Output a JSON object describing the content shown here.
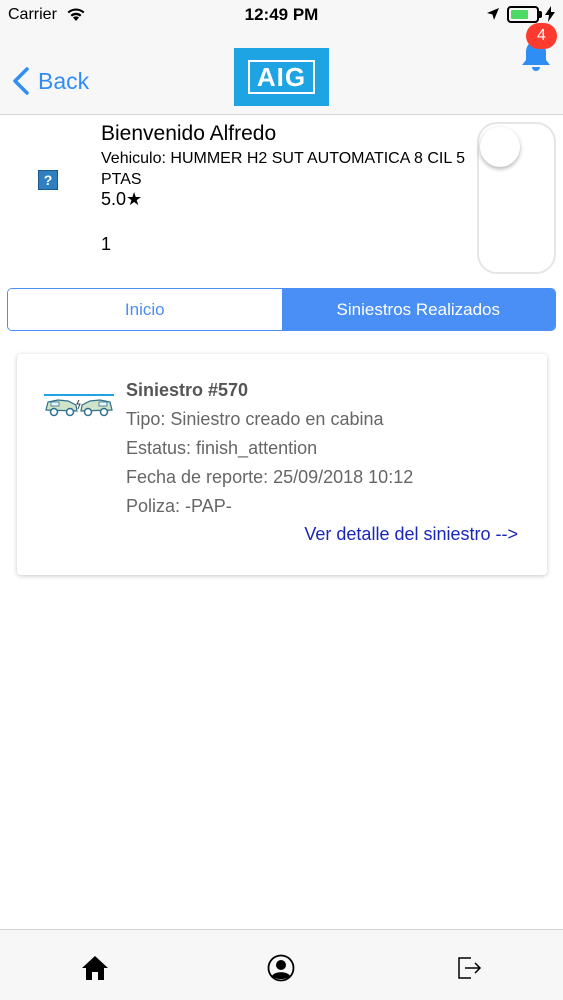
{
  "status_bar": {
    "carrier": "Carrier",
    "time": "12:49 PM",
    "battery_level": 0.7
  },
  "nav": {
    "back_label": "Back",
    "logo_text": "AIG",
    "notification_count": "4"
  },
  "profile": {
    "welcome": "Bienvenido Alfredo",
    "vehicle": "Vehiculo: HUMMER H2 SUT AUTOMATICA 8 CIL 5 PTAS",
    "rating": "5.0★",
    "count": "1",
    "image_placeholder": "?"
  },
  "tabs": [
    {
      "label": "Inicio",
      "active": false
    },
    {
      "label": "Siniestros Realizados",
      "active": true
    }
  ],
  "claim": {
    "title": "Siniestro #570",
    "tipo": "Tipo: Siniestro creado en cabina",
    "estatus": "Estatus: finish_attention",
    "fecha": "Fecha de reporte: 25/09/2018 10:12",
    "poliza": "Poliza: -PAP-",
    "detail_link": "Ver detalle del siniestro -->"
  },
  "tab_bar": {
    "items": [
      "home-icon",
      "profile-icon",
      "logout-icon"
    ]
  },
  "colors": {
    "accent": "#4a8ff5",
    "link": "#1a26b8",
    "brand": "#1ea4e3",
    "badge": "#ff3b30"
  }
}
